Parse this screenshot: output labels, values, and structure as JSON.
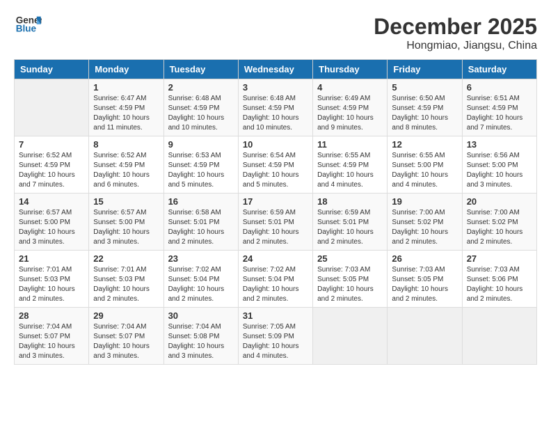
{
  "header": {
    "logo_line1": "General",
    "logo_line2": "Blue",
    "month": "December 2025",
    "location": "Hongmiao, Jiangsu, China"
  },
  "days_of_week": [
    "Sunday",
    "Monday",
    "Tuesday",
    "Wednesday",
    "Thursday",
    "Friday",
    "Saturday"
  ],
  "weeks": [
    [
      {
        "day": "",
        "info": ""
      },
      {
        "day": "1",
        "info": "Sunrise: 6:47 AM\nSunset: 4:59 PM\nDaylight: 10 hours\nand 11 minutes."
      },
      {
        "day": "2",
        "info": "Sunrise: 6:48 AM\nSunset: 4:59 PM\nDaylight: 10 hours\nand 10 minutes."
      },
      {
        "day": "3",
        "info": "Sunrise: 6:48 AM\nSunset: 4:59 PM\nDaylight: 10 hours\nand 10 minutes."
      },
      {
        "day": "4",
        "info": "Sunrise: 6:49 AM\nSunset: 4:59 PM\nDaylight: 10 hours\nand 9 minutes."
      },
      {
        "day": "5",
        "info": "Sunrise: 6:50 AM\nSunset: 4:59 PM\nDaylight: 10 hours\nand 8 minutes."
      },
      {
        "day": "6",
        "info": "Sunrise: 6:51 AM\nSunset: 4:59 PM\nDaylight: 10 hours\nand 7 minutes."
      }
    ],
    [
      {
        "day": "7",
        "info": "Sunrise: 6:52 AM\nSunset: 4:59 PM\nDaylight: 10 hours\nand 7 minutes."
      },
      {
        "day": "8",
        "info": "Sunrise: 6:52 AM\nSunset: 4:59 PM\nDaylight: 10 hours\nand 6 minutes."
      },
      {
        "day": "9",
        "info": "Sunrise: 6:53 AM\nSunset: 4:59 PM\nDaylight: 10 hours\nand 5 minutes."
      },
      {
        "day": "10",
        "info": "Sunrise: 6:54 AM\nSunset: 4:59 PM\nDaylight: 10 hours\nand 5 minutes."
      },
      {
        "day": "11",
        "info": "Sunrise: 6:55 AM\nSunset: 4:59 PM\nDaylight: 10 hours\nand 4 minutes."
      },
      {
        "day": "12",
        "info": "Sunrise: 6:55 AM\nSunset: 5:00 PM\nDaylight: 10 hours\nand 4 minutes."
      },
      {
        "day": "13",
        "info": "Sunrise: 6:56 AM\nSunset: 5:00 PM\nDaylight: 10 hours\nand 3 minutes."
      }
    ],
    [
      {
        "day": "14",
        "info": "Sunrise: 6:57 AM\nSunset: 5:00 PM\nDaylight: 10 hours\nand 3 minutes."
      },
      {
        "day": "15",
        "info": "Sunrise: 6:57 AM\nSunset: 5:00 PM\nDaylight: 10 hours\nand 3 minutes."
      },
      {
        "day": "16",
        "info": "Sunrise: 6:58 AM\nSunset: 5:01 PM\nDaylight: 10 hours\nand 2 minutes."
      },
      {
        "day": "17",
        "info": "Sunrise: 6:59 AM\nSunset: 5:01 PM\nDaylight: 10 hours\nand 2 minutes."
      },
      {
        "day": "18",
        "info": "Sunrise: 6:59 AM\nSunset: 5:01 PM\nDaylight: 10 hours\nand 2 minutes."
      },
      {
        "day": "19",
        "info": "Sunrise: 7:00 AM\nSunset: 5:02 PM\nDaylight: 10 hours\nand 2 minutes."
      },
      {
        "day": "20",
        "info": "Sunrise: 7:00 AM\nSunset: 5:02 PM\nDaylight: 10 hours\nand 2 minutes."
      }
    ],
    [
      {
        "day": "21",
        "info": "Sunrise: 7:01 AM\nSunset: 5:03 PM\nDaylight: 10 hours\nand 2 minutes."
      },
      {
        "day": "22",
        "info": "Sunrise: 7:01 AM\nSunset: 5:03 PM\nDaylight: 10 hours\nand 2 minutes."
      },
      {
        "day": "23",
        "info": "Sunrise: 7:02 AM\nSunset: 5:04 PM\nDaylight: 10 hours\nand 2 minutes."
      },
      {
        "day": "24",
        "info": "Sunrise: 7:02 AM\nSunset: 5:04 PM\nDaylight: 10 hours\nand 2 minutes."
      },
      {
        "day": "25",
        "info": "Sunrise: 7:03 AM\nSunset: 5:05 PM\nDaylight: 10 hours\nand 2 minutes."
      },
      {
        "day": "26",
        "info": "Sunrise: 7:03 AM\nSunset: 5:05 PM\nDaylight: 10 hours\nand 2 minutes."
      },
      {
        "day": "27",
        "info": "Sunrise: 7:03 AM\nSunset: 5:06 PM\nDaylight: 10 hours\nand 2 minutes."
      }
    ],
    [
      {
        "day": "28",
        "info": "Sunrise: 7:04 AM\nSunset: 5:07 PM\nDaylight: 10 hours\nand 3 minutes."
      },
      {
        "day": "29",
        "info": "Sunrise: 7:04 AM\nSunset: 5:07 PM\nDaylight: 10 hours\nand 3 minutes."
      },
      {
        "day": "30",
        "info": "Sunrise: 7:04 AM\nSunset: 5:08 PM\nDaylight: 10 hours\nand 3 minutes."
      },
      {
        "day": "31",
        "info": "Sunrise: 7:05 AM\nSunset: 5:09 PM\nDaylight: 10 hours\nand 4 minutes."
      },
      {
        "day": "",
        "info": ""
      },
      {
        "day": "",
        "info": ""
      },
      {
        "day": "",
        "info": ""
      }
    ]
  ]
}
